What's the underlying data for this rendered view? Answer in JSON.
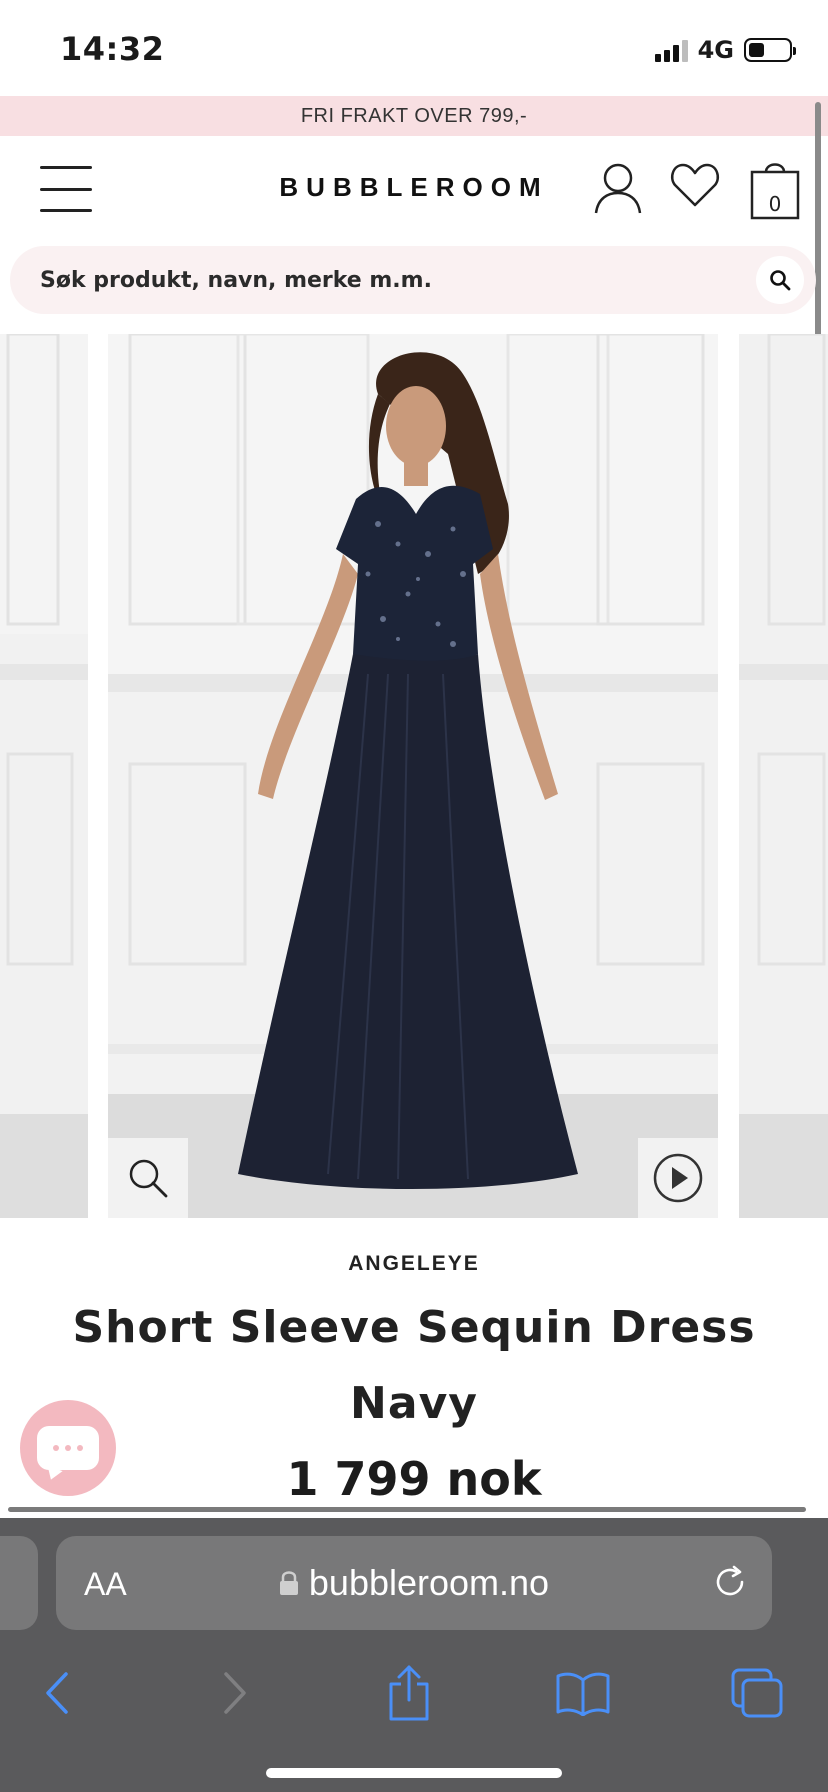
{
  "status_bar": {
    "time": "14:32",
    "network": "4G",
    "battery_level": 0.4
  },
  "promo": {
    "text": "FRI FRAKT OVER 799,-"
  },
  "header": {
    "logo": "BUBBLEROOM",
    "bag_count": "0"
  },
  "search": {
    "placeholder": "Søk produkt, navn, merke m.m."
  },
  "product": {
    "brand": "ANGELEYE",
    "title": "Short Sleeve Sequin Dress Navy",
    "price": "1 799 nok"
  },
  "safari": {
    "text_size_label": "AA",
    "url": "bubbleroom.no"
  },
  "colors": {
    "promo_bg": "#f8dfe2",
    "chat_accent": "#f3b9c0",
    "ios_blue": "#4a8ff7",
    "safari_bar": "#5a5a5c"
  }
}
